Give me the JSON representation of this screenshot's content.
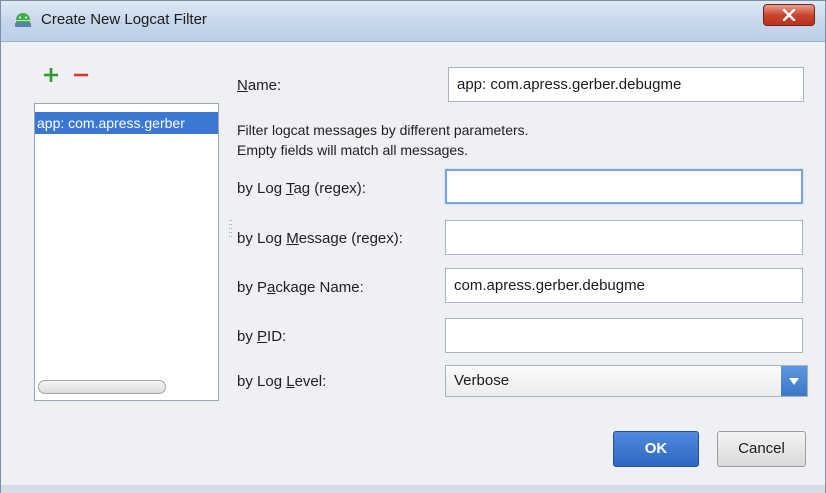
{
  "window": {
    "title": "Create New Logcat Filter",
    "accent": "#3a78d4",
    "close_icon": "close-x-icon"
  },
  "toolbar": {
    "add_icon": "plus-icon",
    "add_color": "#2e9a2e",
    "remove_icon": "minus-icon",
    "remove_color": "#d23a2e"
  },
  "filter_list": {
    "items": [
      "app: com.apress.gerber"
    ],
    "selected_index": 0
  },
  "form": {
    "name_label_prefix": "N",
    "name_label_rest": "ame:",
    "name_value": "app: com.apress.gerber.debugme",
    "description_line1": "Filter logcat messages by different parameters.",
    "description_line2": "Empty fields will match all messages.",
    "log_tag_label_pre": "by Log ",
    "log_tag_label_u": "T",
    "log_tag_label_post": "ag (regex):",
    "log_tag_value": "",
    "log_message_label_pre": "by Log ",
    "log_message_label_u": "M",
    "log_message_label_post": "essage (regex):",
    "log_message_value": "",
    "package_label_pre": "by P",
    "package_label_u": "a",
    "package_label_post": "ckage Name:",
    "package_value": "com.apress.gerber.debugme",
    "pid_label_pre": "by ",
    "pid_label_u": "P",
    "pid_label_post": "ID:",
    "pid_value": "",
    "log_level_label_pre": "by Log ",
    "log_level_label_u": "L",
    "log_level_label_post": "evel:",
    "log_level_value": "Verbose"
  },
  "buttons": {
    "ok": "OK",
    "cancel": "Cancel"
  }
}
